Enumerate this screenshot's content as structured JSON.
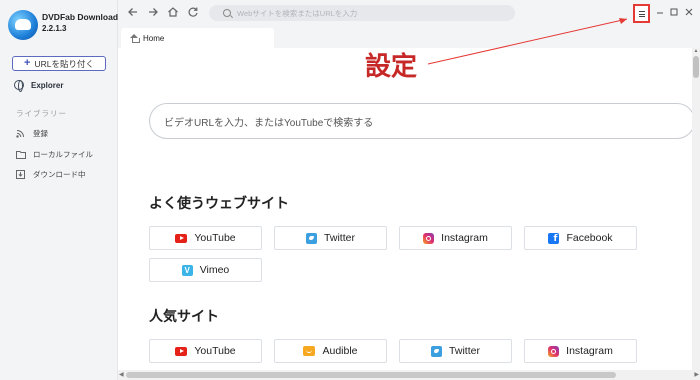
{
  "app": {
    "name": "DVDFab Downloader",
    "version": "2.2.1.3"
  },
  "sidebar": {
    "paste_url_label": "URLを貼り付く",
    "explorer_label": "Explorer",
    "library_title": "ライブラリー",
    "library_items": [
      {
        "label": "登録",
        "icon": "rss-icon"
      },
      {
        "label": "ローカルファイル",
        "icon": "folder-icon"
      },
      {
        "label": "ダウンロード中",
        "icon": "download-icon"
      }
    ]
  },
  "topbar": {
    "search_placeholder": "Webサイトを検索またはURLを入力"
  },
  "tabs": [
    {
      "label": "Home"
    }
  ],
  "main": {
    "search_placeholder": "ビデオURLを入力、またはYouTubeで検索する",
    "favorites_title": "よく使うウェブサイト",
    "favorites": [
      {
        "label": "YouTube",
        "icon": "youtube-icon"
      },
      {
        "label": "Twitter",
        "icon": "twitter-icon"
      },
      {
        "label": "Instagram",
        "icon": "instagram-icon"
      },
      {
        "label": "Facebook",
        "icon": "facebook-icon"
      },
      {
        "label": "Vimeo",
        "icon": "vimeo-icon"
      }
    ],
    "popular_title": "人気サイト",
    "popular": [
      {
        "label": "YouTube",
        "icon": "youtube-icon"
      },
      {
        "label": "Audible",
        "icon": "audible-icon"
      },
      {
        "label": "Twitter",
        "icon": "twitter-icon"
      },
      {
        "label": "Instagram",
        "icon": "instagram-icon"
      }
    ]
  },
  "annotation": {
    "text": "設定",
    "color": "#c62828"
  }
}
